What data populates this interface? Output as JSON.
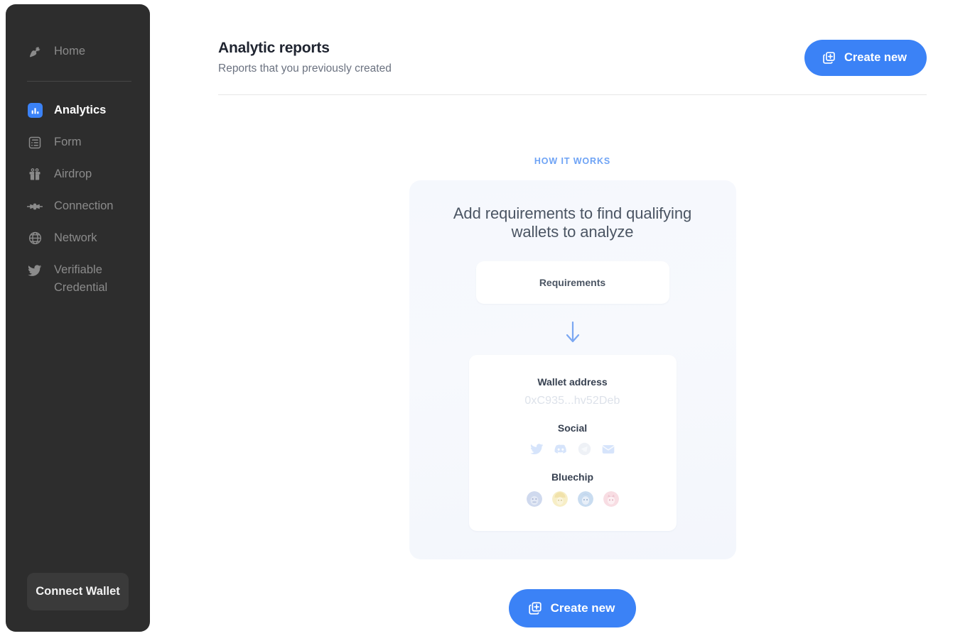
{
  "sidebar": {
    "items": [
      {
        "label": "Home",
        "icon": "carrot-icon",
        "active": false
      },
      {
        "label": "Analytics",
        "icon": "bar-chart-icon",
        "active": true
      },
      {
        "label": "Form",
        "icon": "form-list-icon",
        "active": false
      },
      {
        "label": "Airdrop",
        "icon": "gift-icon",
        "active": false
      },
      {
        "label": "Connection",
        "icon": "plug-connection-icon",
        "active": false
      },
      {
        "label": "Network",
        "icon": "globe-icon",
        "active": false
      },
      {
        "label": "Verifiable\nCredential",
        "icon": "twitter-bird-icon",
        "active": false
      }
    ],
    "connect_wallet_label": "Connect Wallet"
  },
  "header": {
    "title": "Analytic reports",
    "subtitle": "Reports that you previously created",
    "create_button_label": "Create new",
    "create_button_icon": "duplicate-plus-icon"
  },
  "how_it_works": {
    "eyebrow": "HOW IT WORKS",
    "heading": "Add requirements to find qualifying wallets to analyze",
    "requirements_label": "Requirements",
    "arrow_icon": "arrow-down-icon",
    "wallet": {
      "address_label": "Wallet address",
      "address_value": "0xC935...hv52Deb",
      "social_label": "Social",
      "social_icons": [
        "twitter-icon",
        "discord-icon",
        "telegram-icon",
        "email-icon"
      ],
      "bluechip_label": "Bluechip",
      "bluechip_icons": [
        "nft-avatar-1",
        "nft-avatar-2",
        "nft-avatar-3",
        "nft-avatar-4"
      ]
    }
  },
  "footer": {
    "create_button_label": "Create new",
    "create_button_icon": "duplicate-plus-icon"
  },
  "colors": {
    "accent": "#3b82f6",
    "sidebar_bg": "#2d2d2d",
    "sidebar_text": "#8b8b8b",
    "card_bg": "#f5f8fd",
    "eyebrow": "#6ea3f5"
  }
}
